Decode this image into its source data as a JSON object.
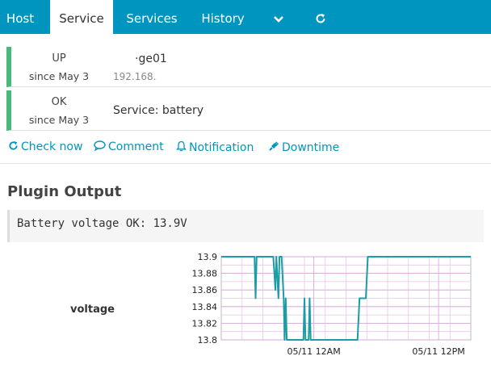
{
  "tabs": [
    {
      "label": "Host",
      "active": false
    },
    {
      "label": "Service",
      "active": true
    },
    {
      "label": "Services",
      "active": false
    },
    {
      "label": "History",
      "active": false
    }
  ],
  "tab_icons": {
    "more": "chevron-down-icon",
    "refresh": "refresh-icon"
  },
  "host": {
    "state": "UP",
    "since": "since May 3",
    "name": "·ge01",
    "address": "192.168."
  },
  "service": {
    "state": "OK",
    "since": "since May 3",
    "name": "Service: battery"
  },
  "actions": {
    "check_now": "Check now",
    "comment": "Comment",
    "notification": "Notification",
    "downtime": "Downtime"
  },
  "plugin_output": {
    "title": "Plugin Output",
    "text": "Battery voltage OK: 13.9V"
  },
  "perfdata": {
    "label": "voltage"
  },
  "colors": {
    "accent": "#0095bf",
    "ok": "#44bb77",
    "line": "#1a9ea3"
  },
  "chart_data": {
    "type": "line",
    "title": "",
    "xlabel": "",
    "ylabel": "",
    "ylim": [
      13.8,
      13.9
    ],
    "yticks": [
      "13.9",
      "13.88",
      "13.86",
      "13.84",
      "13.82",
      "13.8"
    ],
    "xticks": [
      "05/11 12AM",
      "05/11 12PM"
    ],
    "xtick_positions_hours": [
      8.9,
      20.9
    ],
    "x_unit": "hours since start of plotted window",
    "series": [
      {
        "values": [
          [
            0,
            13.9
          ],
          [
            3.2,
            13.9
          ],
          [
            3.3,
            13.85
          ],
          [
            3.4,
            13.9
          ],
          [
            5.0,
            13.9
          ],
          [
            5.2,
            13.86
          ],
          [
            5.3,
            13.9
          ],
          [
            5.5,
            13.85
          ],
          [
            5.6,
            13.9
          ],
          [
            5.8,
            13.9
          ],
          [
            6.0,
            13.85
          ],
          [
            6.1,
            13.8
          ],
          [
            6.2,
            13.85
          ],
          [
            6.3,
            13.8
          ],
          [
            7.9,
            13.8
          ],
          [
            8.0,
            13.85
          ],
          [
            8.1,
            13.8
          ],
          [
            8.4,
            13.8
          ],
          [
            8.5,
            13.85
          ],
          [
            8.6,
            13.8
          ],
          [
            13.1,
            13.8
          ],
          [
            13.3,
            13.85
          ],
          [
            13.9,
            13.85
          ],
          [
            14.1,
            13.9
          ],
          [
            24.0,
            13.9
          ]
        ]
      }
    ]
  }
}
